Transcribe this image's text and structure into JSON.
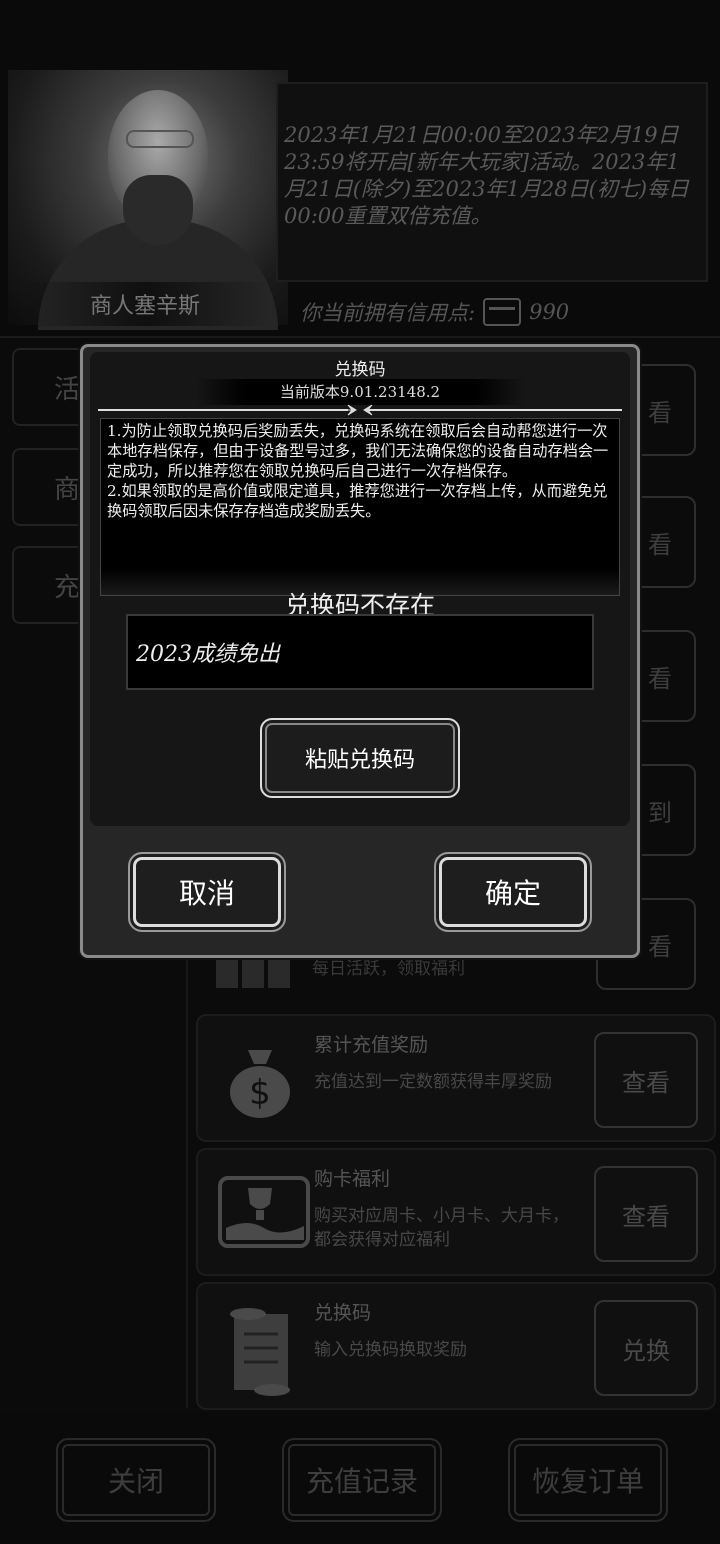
{
  "background": {
    "merchant_name": "商人塞辛斯",
    "event_text": "2023年1月21日00:00至2023年2月19日23:59将开启[新年大玩家]活动。2023年1月21日(除夕)至2023年1月28日(初七)每日00:00重置双倍充值。",
    "credit_text": "你当前拥有信用点:",
    "credit_value": "990",
    "side_tabs": [
      "活",
      "商",
      "充"
    ],
    "upper_buttons": [
      "看",
      "看",
      "看",
      "到",
      "看"
    ],
    "row_partial_desc": "每日活跃，领取福利",
    "rows": [
      {
        "title": "累计充值奖励",
        "desc": "充值达到一定数额获得丰厚奖励",
        "button": "查看",
        "icon": "money-bag-icon"
      },
      {
        "title": "购卡福利",
        "desc": "购买对应周卡、小月卡、大月卡，都会获得对应福利",
        "button": "查看",
        "icon": "trophy-card-icon"
      },
      {
        "title": "兑换码",
        "desc": "输入兑换码换取奖励",
        "button": "兑换",
        "icon": "scroll-icon"
      }
    ],
    "bottom_buttons": {
      "close": "关闭",
      "recharge_log": "充值记录",
      "restore_order": "恢复订单"
    }
  },
  "dialog": {
    "title": "兑换码",
    "version": "当前版本9.01.23148.2",
    "notice": "1.为防止领取兑换码后奖励丢失，兑换码系统在领取后会自动帮您进行一次本地存档保存，但由于设备型号过多，我们无法确保您的设备自动存档会一定成功，所以推荐您在领取兑换码后自己进行一次存档保存。\n2.如果领取的是高价值或限定道具，推荐您进行一次存档上传，从而避免兑换码领取后因未保存存档造成奖励丢失。",
    "status": "兑换码不存在",
    "input_value": "2023成绩免出",
    "paste_label": "粘贴兑换码",
    "cancel_label": "取消",
    "confirm_label": "确定"
  }
}
